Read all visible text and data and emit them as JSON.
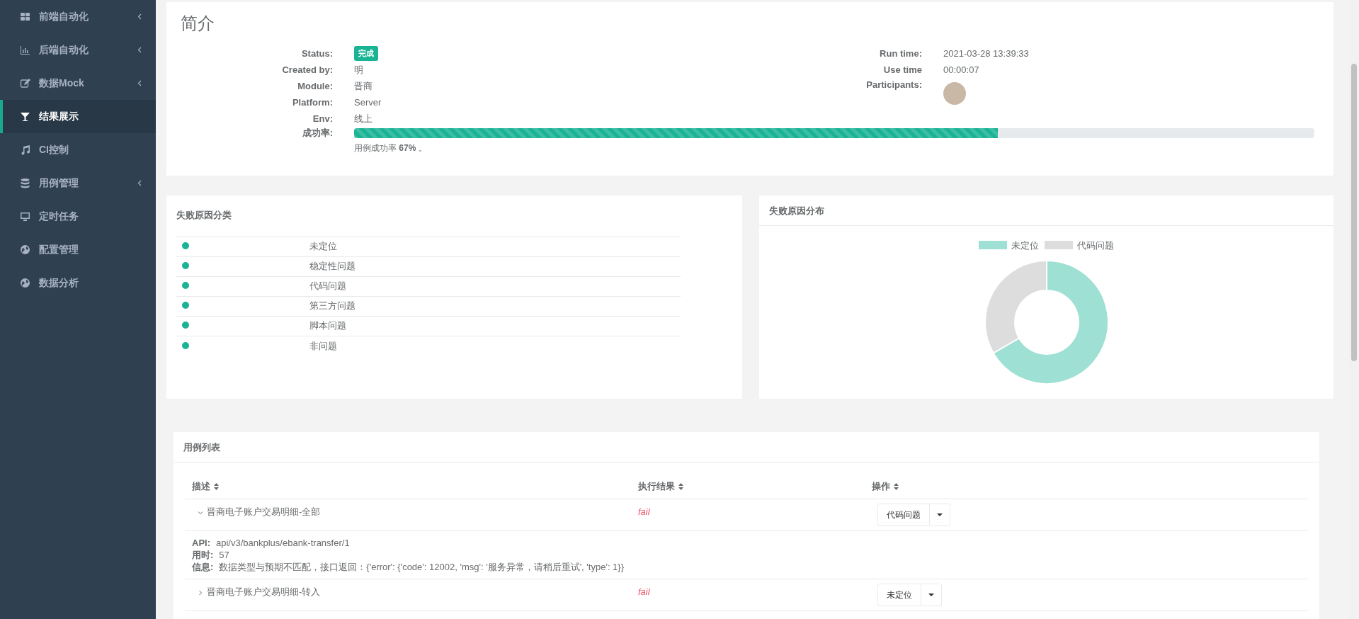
{
  "sidebar": {
    "items": [
      {
        "label": "前端自动化",
        "has_submenu": true,
        "selected": false
      },
      {
        "label": "后端自动化",
        "has_submenu": true,
        "selected": false
      },
      {
        "label": "数据Mock",
        "has_submenu": true,
        "selected": false
      },
      {
        "label": "结果展示",
        "has_submenu": false,
        "selected": true
      },
      {
        "label": "CI控制",
        "has_submenu": false,
        "selected": false
      },
      {
        "label": "用例管理",
        "has_submenu": true,
        "selected": false
      },
      {
        "label": "定时任务",
        "has_submenu": false,
        "selected": false
      },
      {
        "label": "配置管理",
        "has_submenu": false,
        "selected": false
      },
      {
        "label": "数据分析",
        "has_submenu": false,
        "selected": false
      }
    ]
  },
  "summary": {
    "title": "简介",
    "left": [
      {
        "label": "Status:",
        "value": "完成",
        "kind": "badge"
      },
      {
        "label": "Created by:",
        "value": "明",
        "kind": "text"
      },
      {
        "label": "Module:",
        "value": "晋商",
        "kind": "text"
      },
      {
        "label": "Platform:",
        "value": "Server",
        "kind": "text"
      },
      {
        "label": "Env:",
        "value": "线上",
        "kind": "text"
      }
    ],
    "right": [
      {
        "label": "Run time:",
        "value": "2021-03-28 13:39:33",
        "kind": "text"
      },
      {
        "label": "Use time",
        "value": "00:00:07",
        "kind": "text"
      },
      {
        "label": "Participants:",
        "kind": "avatar"
      }
    ],
    "success": {
      "label": "成功率:",
      "level": 0.67,
      "caption": "用例成功率 **67%** 。"
    }
  },
  "failure_categories": {
    "title": "失败原因分类",
    "items": [
      {
        "label": "未定位",
        "color": "#1ab394"
      },
      {
        "label": "稳定性问题",
        "color": "#1ab394"
      },
      {
        "label": "代码问题",
        "color": "#1ab394"
      },
      {
        "label": "第三方问题",
        "color": "#1ab394"
      },
      {
        "label": "脚本问题",
        "color": "#1ab394"
      },
      {
        "label": "非问题",
        "color": "#1ab394"
      }
    ]
  },
  "failure_distribution": {
    "title": "失败原因分布",
    "legend": [
      {
        "label": "未定位",
        "color": "#9fe0d4"
      },
      {
        "label": "代码问题",
        "color": "#dddddd"
      }
    ]
  },
  "case_table": {
    "title": "用例列表",
    "columns": [
      "描述",
      "执行结果",
      "操作"
    ],
    "rows": [
      {
        "description": "晋商电子账户交易明细-全部",
        "result": "fail",
        "action": "代码问题",
        "expanded": true,
        "details": [
          {
            "label": "API:",
            "value": "api/v3/bankplus/ebank-transfer/1"
          },
          {
            "label": "用时:",
            "value": "57"
          },
          {
            "label": "信息:",
            "value": "数据类型与预期不匹配，接口返回：{'error': {'code': 12002, 'msg': '服务异常，请稍后重试', 'type': 1}}"
          }
        ]
      },
      {
        "description": "晋商电子账户交易明细-转入",
        "result": "fail",
        "action": "未定位",
        "expanded": false
      }
    ]
  }
}
